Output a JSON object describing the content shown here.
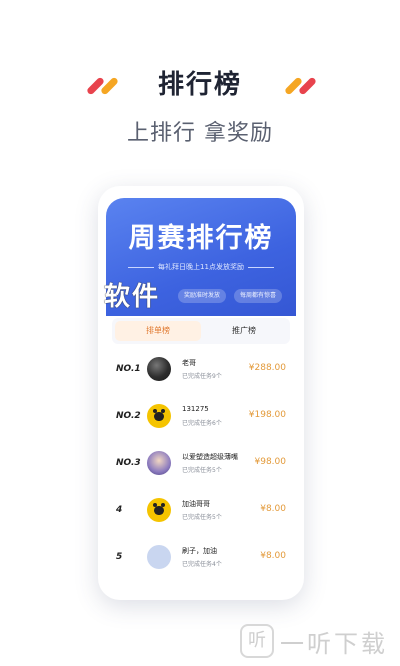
{
  "header": {
    "title": "排行榜",
    "subtitle": "上排行 拿奖励",
    "accent_colors": [
      "#e8434d",
      "#f5a623"
    ]
  },
  "banner": {
    "title": "周赛排行榜",
    "subtitle": "每礼拜日晚上11点发放奖励",
    "pills": [
      "奖励准时发放",
      "每周都有惊喜"
    ],
    "color": "#3d63e0"
  },
  "watermark_text": "软件",
  "tabs": [
    "排单榜",
    "推广榜"
  ],
  "leaderboard": [
    {
      "rank": "NO.1",
      "name": "老哥",
      "tasks": "已完成任务9个",
      "reward": "¥288.00",
      "avatar": "photo-avatar"
    },
    {
      "rank": "NO.2",
      "name": "131275",
      "tasks": "已完成任务6个",
      "reward": "¥198.00",
      "avatar": "bear-avatar"
    },
    {
      "rank": "NO.3",
      "name": "以爱塑造超级薄嘴",
      "tasks": "已完成任务5个",
      "reward": "¥98.00",
      "avatar": "anime-avatar"
    },
    {
      "rank": "4",
      "name": "加油哥哥",
      "tasks": "已完成任务5个",
      "reward": "¥8.00",
      "avatar": "bear-avatar"
    },
    {
      "rank": "5",
      "name": "刷子，加油",
      "tasks": "已完成任务4个",
      "reward": "¥8.00",
      "avatar": "default-avatar"
    }
  ],
  "footer": {
    "icon_glyph": "听",
    "brand": "一听下载"
  }
}
